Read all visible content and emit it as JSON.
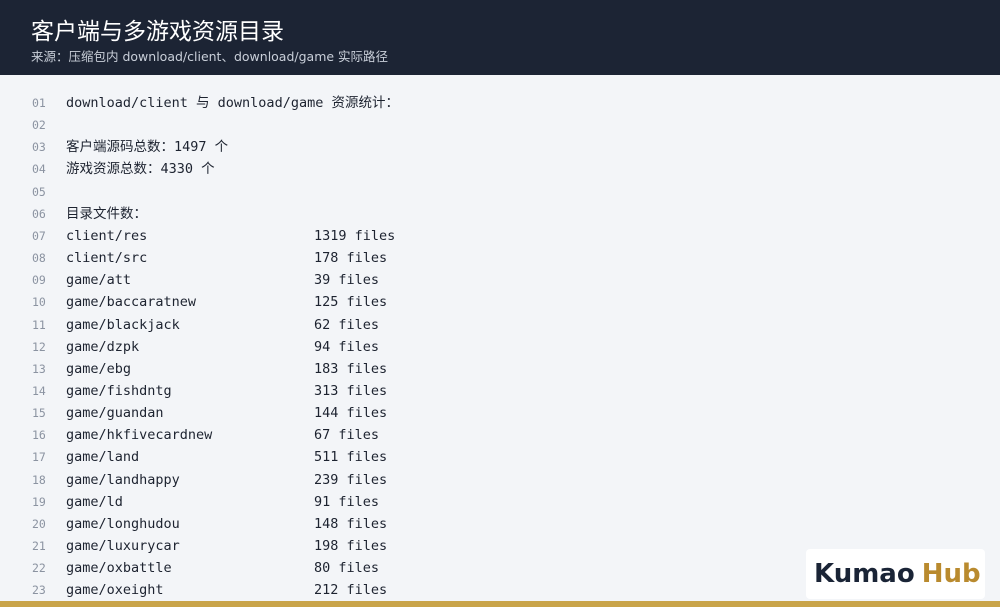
{
  "header": {
    "title": "客户端与多游戏资源目录",
    "subtitle": "来源：压缩包内 download/client、download/game 实际路径"
  },
  "lines": [
    {
      "no": "01",
      "text": "download/client 与 download/game 资源统计：",
      "count": ""
    },
    {
      "no": "02",
      "text": "",
      "count": ""
    },
    {
      "no": "03",
      "text": "客户端源码总数：1497 个",
      "count": ""
    },
    {
      "no": "04",
      "text": "游戏资源总数：4330 个",
      "count": ""
    },
    {
      "no": "05",
      "text": "",
      "count": ""
    },
    {
      "no": "06",
      "text": "目录文件数：",
      "count": ""
    },
    {
      "no": "07",
      "text": "client/res",
      "count": "1319 files"
    },
    {
      "no": "08",
      "text": "client/src",
      "count": "178 files"
    },
    {
      "no": "09",
      "text": "game/att",
      "count": "39 files"
    },
    {
      "no": "10",
      "text": "game/baccaratnew",
      "count": "125 files"
    },
    {
      "no": "11",
      "text": "game/blackjack",
      "count": "62 files"
    },
    {
      "no": "12",
      "text": "game/dzpk",
      "count": "94 files"
    },
    {
      "no": "13",
      "text": "game/ebg",
      "count": "183 files"
    },
    {
      "no": "14",
      "text": "game/fishdntg",
      "count": "313 files"
    },
    {
      "no": "15",
      "text": "game/guandan",
      "count": "144 files"
    },
    {
      "no": "16",
      "text": "game/hkfivecardnew",
      "count": "67 files"
    },
    {
      "no": "17",
      "text": "game/land",
      "count": "511 files"
    },
    {
      "no": "18",
      "text": "game/landhappy",
      "count": "239 files"
    },
    {
      "no": "19",
      "text": "game/ld",
      "count": "91 files"
    },
    {
      "no": "20",
      "text": "game/longhudou",
      "count": "148 files"
    },
    {
      "no": "21",
      "text": "game/luxurycar",
      "count": "198 files"
    },
    {
      "no": "22",
      "text": "game/oxbattle",
      "count": "80 files"
    },
    {
      "no": "23",
      "text": "game/oxeight",
      "count": "212 files"
    }
  ],
  "logo": {
    "part1": "Kumao",
    "part2": "Hub"
  },
  "colors": {
    "header_bg": "#1c2434",
    "accent": "#c9a449",
    "logo_dark": "#1a2436",
    "logo_gold": "#b98a2e"
  }
}
